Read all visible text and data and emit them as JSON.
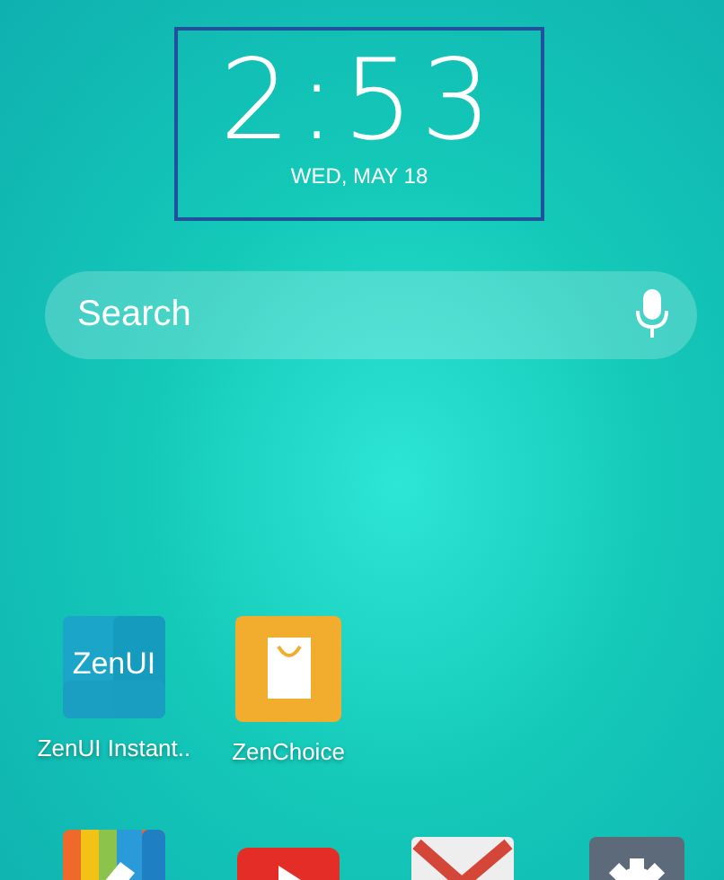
{
  "clock": {
    "time": "2:53",
    "date": "WED, MAY 18"
  },
  "search": {
    "placeholder": "Search"
  },
  "apps": [
    {
      "kind": "zenui",
      "label": "ZenUI Instant..",
      "icon_text": "ZenUI"
    },
    {
      "kind": "zenchoice",
      "label": "ZenChoice"
    }
  ],
  "dock": [
    {
      "kind": "gallery"
    },
    {
      "kind": "video"
    },
    {
      "kind": "mail"
    },
    {
      "kind": "settings"
    }
  ]
}
